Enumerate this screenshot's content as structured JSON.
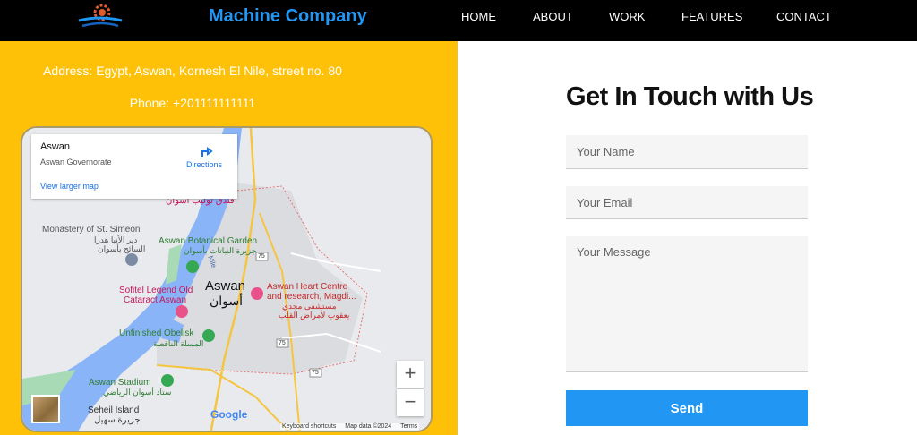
{
  "brand": {
    "name": "Machine Company",
    "logo_icon": "gear-logo-icon"
  },
  "nav": {
    "items": [
      "HOME",
      "ABOUT",
      "WORK",
      "FEATURES",
      "CONTACT"
    ]
  },
  "contact": {
    "address": "Address: Egypt, Aswan, Kornesh El Nile, street no. 80",
    "phone": "Phone: +201111111111"
  },
  "map": {
    "card": {
      "title": "Aswan",
      "subtitle": "Aswan Governorate",
      "directions": "Directions",
      "larger": "View larger map"
    },
    "labels": {
      "hotel": "فندق توليب أسوان",
      "monastery": "Monastery of St. Simeon",
      "monastery_ar1": "دير الأنبا هدرا",
      "monastery_ar2": "السائح بأسوان",
      "garden": "Aswan Botanical Garden",
      "garden_ar": "جزيرة النباتات بأسوان",
      "nile": "Nile",
      "city": "Aswan",
      "city_ar": "أسوان",
      "sofitel1": "Sofitel Legend Old",
      "sofitel2": "Cataract Aswan",
      "heart1": "Aswan Heart Centre",
      "heart2": "and research, Magdi...",
      "heart_ar1": "مستشفى مجدي",
      "heart_ar2": "يعقوب لأمراض القلب",
      "obelisk": "Unfinished Obelisk",
      "obelisk_ar": "المسلة الناقصة",
      "stadium": "Aswan Stadium",
      "stadium_ar": "ستاد أسوان الرياضي",
      "seheil": "Seheil Island",
      "seheil_ar": "جزيرة سهيل",
      "road1": "75",
      "road2": "75",
      "road3": "75",
      "google": "Google"
    },
    "zoom_in": "+",
    "zoom_out": "−",
    "attribution": {
      "shortcuts": "Keyboard shortcuts",
      "data": "Map data ©2024",
      "terms": "Terms"
    }
  },
  "form": {
    "title": "Get In Touch with Us",
    "name_placeholder": "Your Name",
    "email_placeholder": "Your Email",
    "message_placeholder": "Your Message",
    "send_label": "Send"
  },
  "colors": {
    "accent": "#2196f3",
    "panel": "#ffc107",
    "nav": "#000000"
  }
}
